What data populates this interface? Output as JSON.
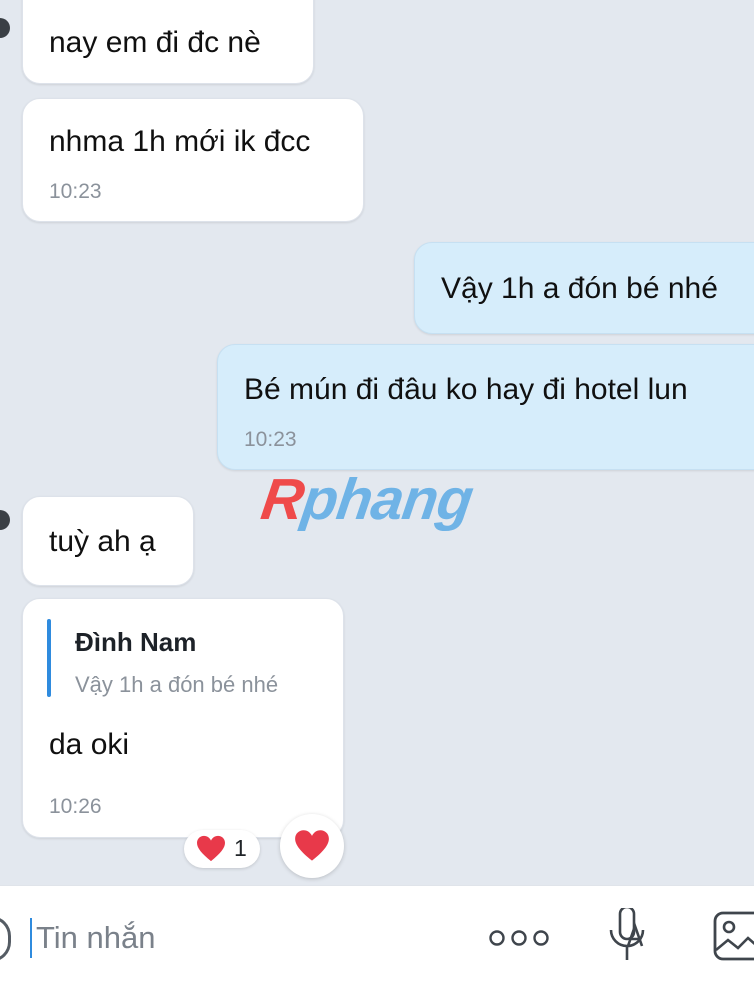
{
  "messages": [
    {
      "id": "m1",
      "side": "in",
      "text": "nay em đi đc nè",
      "time": ""
    },
    {
      "id": "m2",
      "side": "in",
      "text": "nhma 1h mới ik đcc",
      "time": "10:23"
    },
    {
      "id": "m3",
      "side": "out",
      "text": "Vậy 1h a đón bé nhé",
      "time": ""
    },
    {
      "id": "m4",
      "side": "out",
      "text": "Bé mún đi đâu ko hay đi hotel lun",
      "time": "10:23"
    },
    {
      "id": "m5",
      "side": "in",
      "text": "tuỳ ah ạ",
      "time": ""
    },
    {
      "id": "m6",
      "side": "in",
      "text": "da oki",
      "time": "10:26",
      "quote": {
        "name": "Đình Nam",
        "text": "Vậy 1h a đón bé nhé"
      }
    }
  ],
  "reaction": {
    "emoji_icon": "heart-icon",
    "count": "1"
  },
  "watermark": {
    "first": "R",
    "rest": "phang"
  },
  "composer": {
    "placeholder": "Tin nhắn"
  },
  "icons": [
    "more-options-icon",
    "voice-to-text-icon",
    "image-icon"
  ],
  "colors": {
    "background": "#e3e8ef",
    "incoming": "#ffffff",
    "outgoing": "#d6edfb",
    "accent": "#2f8bde",
    "heart": "#e8394a"
  }
}
